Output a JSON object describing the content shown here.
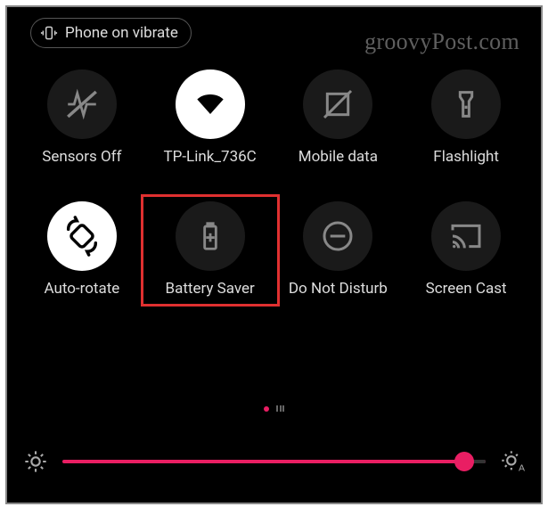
{
  "watermark": "groovyPost.com",
  "vibrate_chip": {
    "label": "Phone on vibrate"
  },
  "tiles": [
    {
      "label": "Sensors Off",
      "icon": "sensors-off-icon",
      "on": false
    },
    {
      "label": "TP-Link_736C",
      "icon": "wifi-icon",
      "on": true
    },
    {
      "label": "Mobile data",
      "icon": "mobile-data-icon",
      "on": false
    },
    {
      "label": "Flashlight",
      "icon": "flashlight-icon",
      "on": false
    },
    {
      "label": "Auto-rotate",
      "icon": "auto-rotate-icon",
      "on": true
    },
    {
      "label": "Battery Saver",
      "icon": "battery-saver-icon",
      "on": false,
      "highlighted": true
    },
    {
      "label": "Do Not Disturb",
      "icon": "dnd-icon",
      "on": false
    },
    {
      "label": "Screen Cast",
      "icon": "screen-cast-icon",
      "on": false
    }
  ],
  "pager": {
    "current": 0,
    "count": 2
  },
  "brightness": {
    "percent": 95
  },
  "colors": {
    "accent": "#e91e63",
    "highlight": "#e03030"
  }
}
